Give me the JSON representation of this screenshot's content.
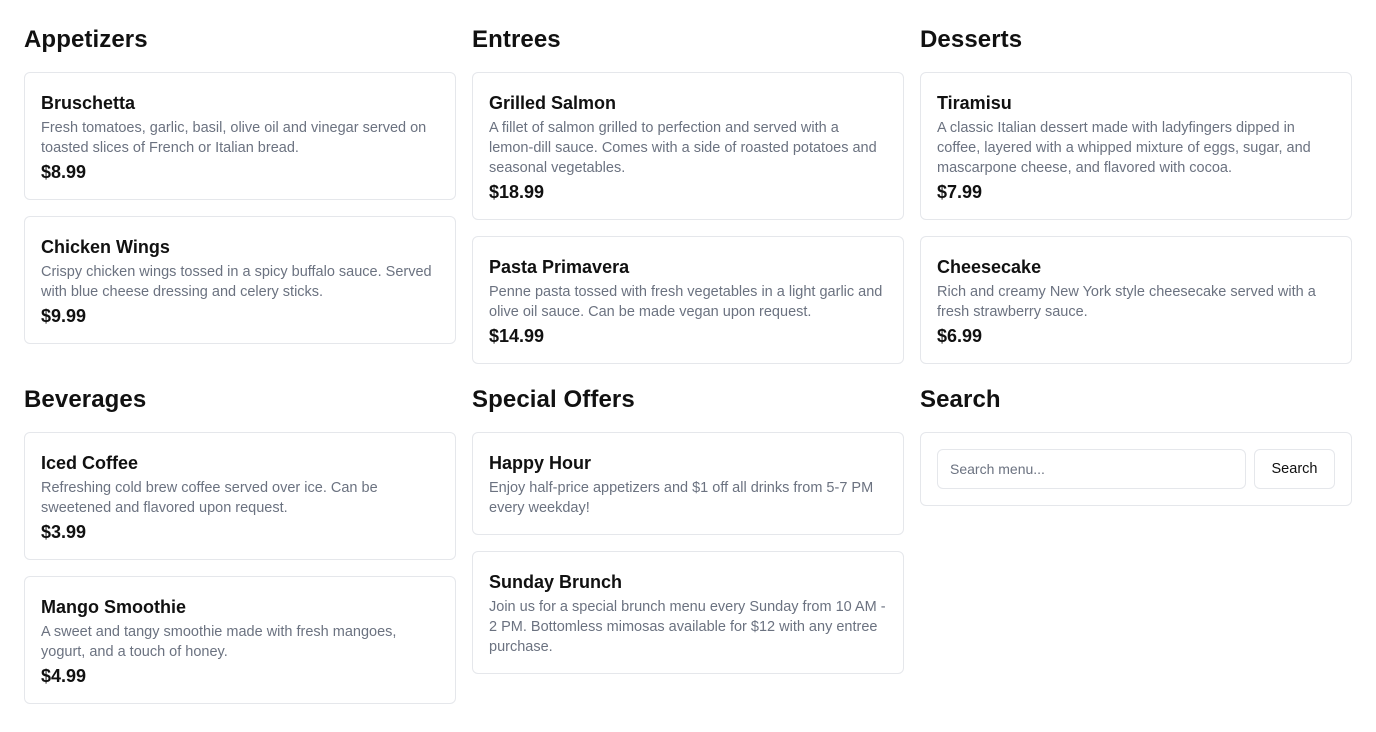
{
  "sections": {
    "appetizers": {
      "title": "Appetizers",
      "items": [
        {
          "name": "Bruschetta",
          "description": "Fresh tomatoes, garlic, basil, olive oil and vinegar served on toasted slices of French or Italian bread.",
          "price": "$8.99"
        },
        {
          "name": "Chicken Wings",
          "description": "Crispy chicken wings tossed in a spicy buffalo sauce. Served with blue cheese dressing and celery sticks.",
          "price": "$9.99"
        }
      ]
    },
    "entrees": {
      "title": "Entrees",
      "items": [
        {
          "name": "Grilled Salmon",
          "description": "A fillet of salmon grilled to perfection and served with a lemon-dill sauce. Comes with a side of roasted potatoes and seasonal vegetables.",
          "price": "$18.99"
        },
        {
          "name": "Pasta Primavera",
          "description": "Penne pasta tossed with fresh vegetables in a light garlic and olive oil sauce. Can be made vegan upon request.",
          "price": "$14.99"
        }
      ]
    },
    "desserts": {
      "title": "Desserts",
      "items": [
        {
          "name": "Tiramisu",
          "description": "A classic Italian dessert made with ladyfingers dipped in coffee, layered with a whipped mixture of eggs, sugar, and mascarpone cheese, and flavored with cocoa.",
          "price": "$7.99"
        },
        {
          "name": "Cheesecake",
          "description": "Rich and creamy New York style cheesecake served with a fresh strawberry sauce.",
          "price": "$6.99"
        }
      ]
    },
    "beverages": {
      "title": "Beverages",
      "items": [
        {
          "name": "Iced Coffee",
          "description": "Refreshing cold brew coffee served over ice. Can be sweetened and flavored upon request.",
          "price": "$3.99"
        },
        {
          "name": "Mango Smoothie",
          "description": "A sweet and tangy smoothie made with fresh mangoes, yogurt, and a touch of honey.",
          "price": "$4.99"
        }
      ]
    },
    "special_offers": {
      "title": "Special Offers",
      "items": [
        {
          "name": "Happy Hour",
          "description": "Enjoy half-price appetizers and $1 off all drinks from 5-7 PM every weekday!"
        },
        {
          "name": "Sunday Brunch",
          "description": "Join us for a special brunch menu every Sunday from 10 AM - 2 PM. Bottomless mimosas available for $12 with any entree purchase."
        }
      ]
    },
    "search": {
      "title": "Search",
      "placeholder": "Search menu...",
      "value": "",
      "button_label": "Search"
    }
  },
  "colors": {
    "text": "#111111",
    "muted": "#6b7280",
    "border": "#e5e7eb",
    "background": "#ffffff"
  }
}
